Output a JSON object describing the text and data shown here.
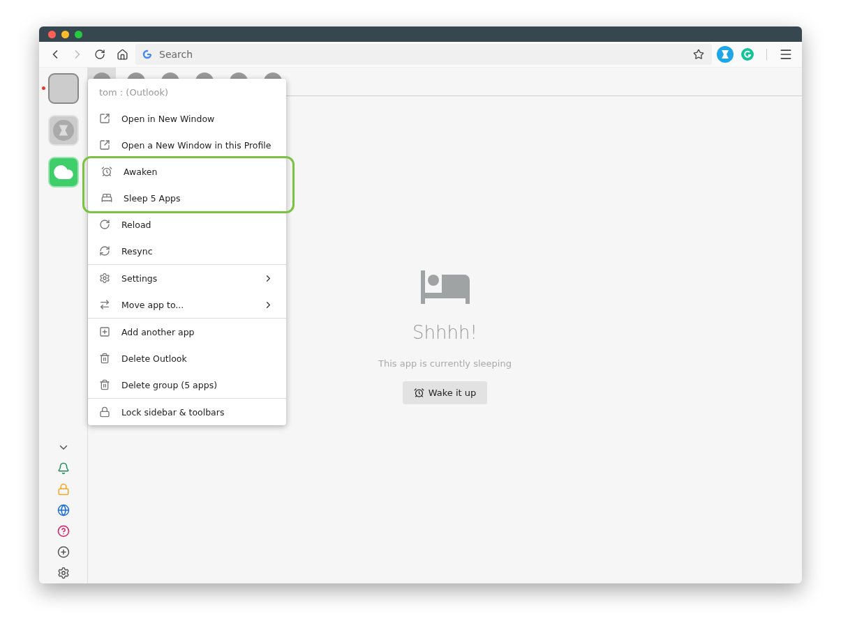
{
  "toolbar": {
    "search_placeholder": "Search"
  },
  "sidebar": {
    "apps": [
      {
        "kind": "blank",
        "selected": true,
        "unread": true
      },
      {
        "kind": "logo",
        "selected": false,
        "unread": false
      },
      {
        "kind": "cloud",
        "selected": false,
        "unread": false
      }
    ],
    "bottom_icons": [
      {
        "kind": "chevron"
      },
      {
        "kind": "bell"
      },
      {
        "kind": "lock"
      },
      {
        "kind": "globe"
      },
      {
        "kind": "help"
      },
      {
        "kind": "add"
      },
      {
        "kind": "settings"
      }
    ]
  },
  "tab_strip": {
    "tabs": [
      {
        "selected": true
      },
      {
        "selected": false
      },
      {
        "selected": false
      },
      {
        "selected": false
      },
      {
        "selected": false
      },
      {
        "selected": false
      }
    ]
  },
  "context_menu": {
    "header": "tom : (Outlook)",
    "sections": [
      [
        {
          "kind": "external",
          "label": "Open in New Window",
          "submenu": false,
          "highlighted": false
        },
        {
          "kind": "external",
          "label": "Open a New Window in this Profile",
          "submenu": false,
          "highlighted": false
        },
        {
          "kind": "alarm",
          "label": "Awaken",
          "submenu": false,
          "highlighted": true
        },
        {
          "kind": "bed",
          "label": "Sleep 5 Apps",
          "submenu": false,
          "highlighted": true
        },
        {
          "kind": "reload",
          "label": "Reload",
          "submenu": false,
          "highlighted": false
        },
        {
          "kind": "sync",
          "label": "Resync",
          "submenu": false,
          "highlighted": false
        }
      ],
      [
        {
          "kind": "gear",
          "label": "Settings",
          "submenu": true,
          "highlighted": false
        },
        {
          "kind": "arrows",
          "label": "Move app to...",
          "submenu": true,
          "highlighted": false
        }
      ],
      [
        {
          "kind": "add",
          "label": "Add another app",
          "submenu": false,
          "highlighted": false
        },
        {
          "kind": "trash",
          "label": "Delete Outlook",
          "submenu": false,
          "highlighted": false
        },
        {
          "kind": "trashgroup",
          "label": "Delete group (5 apps)",
          "submenu": false,
          "highlighted": false
        }
      ],
      [
        {
          "kind": "lock",
          "label": "Lock sidebar & toolbars",
          "submenu": false,
          "highlighted": false
        }
      ]
    ]
  },
  "sleep_screen": {
    "title": "Shhhh!",
    "message": "This app is currently sleeping",
    "button": "Wake it up"
  }
}
